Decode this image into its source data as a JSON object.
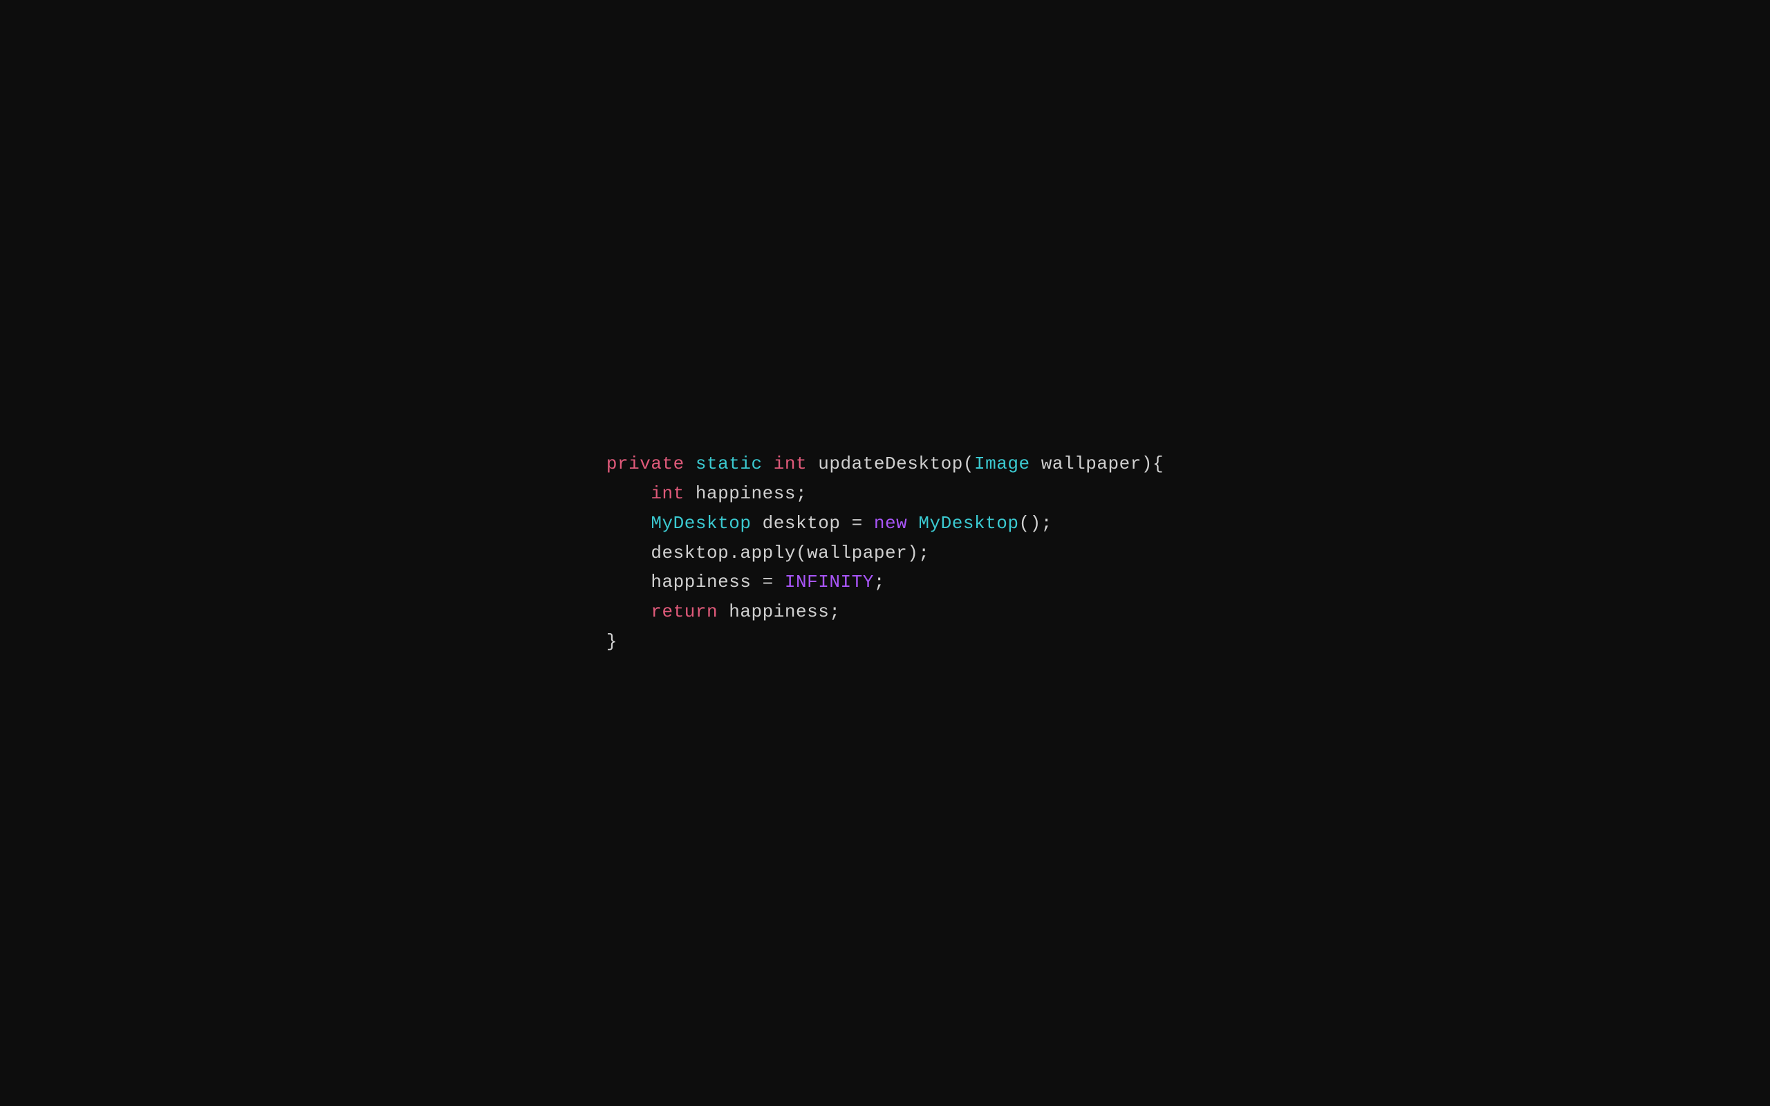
{
  "code": {
    "lines": [
      {
        "id": "line1",
        "parts": [
          {
            "text": "private",
            "class": "kw-private"
          },
          {
            "text": " ",
            "class": "plain"
          },
          {
            "text": "static",
            "class": "kw-static"
          },
          {
            "text": " ",
            "class": "plain"
          },
          {
            "text": "int",
            "class": "kw-int"
          },
          {
            "text": " updateDesktop(",
            "class": "plain"
          },
          {
            "text": "Image",
            "class": "kw-image"
          },
          {
            "text": " wallpaper){",
            "class": "plain"
          }
        ]
      },
      {
        "id": "line2",
        "indent": "    ",
        "parts": [
          {
            "text": "    ",
            "class": "plain"
          },
          {
            "text": "int",
            "class": "kw-int"
          },
          {
            "text": " happiness;",
            "class": "plain"
          }
        ]
      },
      {
        "id": "line3",
        "parts": [
          {
            "text": "    ",
            "class": "plain"
          },
          {
            "text": "MyDesktop",
            "class": "kw-mydesktop"
          },
          {
            "text": " desktop = ",
            "class": "plain"
          },
          {
            "text": "new",
            "class": "kw-new"
          },
          {
            "text": " ",
            "class": "plain"
          },
          {
            "text": "MyDesktop",
            "class": "kw-mydesktop"
          },
          {
            "text": "();",
            "class": "plain"
          }
        ]
      },
      {
        "id": "line4",
        "parts": [
          {
            "text": "    desktop.apply(wallpaper);",
            "class": "plain"
          }
        ]
      },
      {
        "id": "line5",
        "parts": [
          {
            "text": "    happiness = ",
            "class": "plain"
          },
          {
            "text": "INFINITY",
            "class": "kw-infinity"
          },
          {
            "text": ";",
            "class": "plain"
          }
        ]
      },
      {
        "id": "line6",
        "parts": [
          {
            "text": "    ",
            "class": "plain"
          },
          {
            "text": "return",
            "class": "kw-return"
          },
          {
            "text": " happiness;",
            "class": "plain"
          }
        ]
      },
      {
        "id": "line7",
        "parts": [
          {
            "text": "}",
            "class": "brace"
          }
        ]
      }
    ]
  }
}
